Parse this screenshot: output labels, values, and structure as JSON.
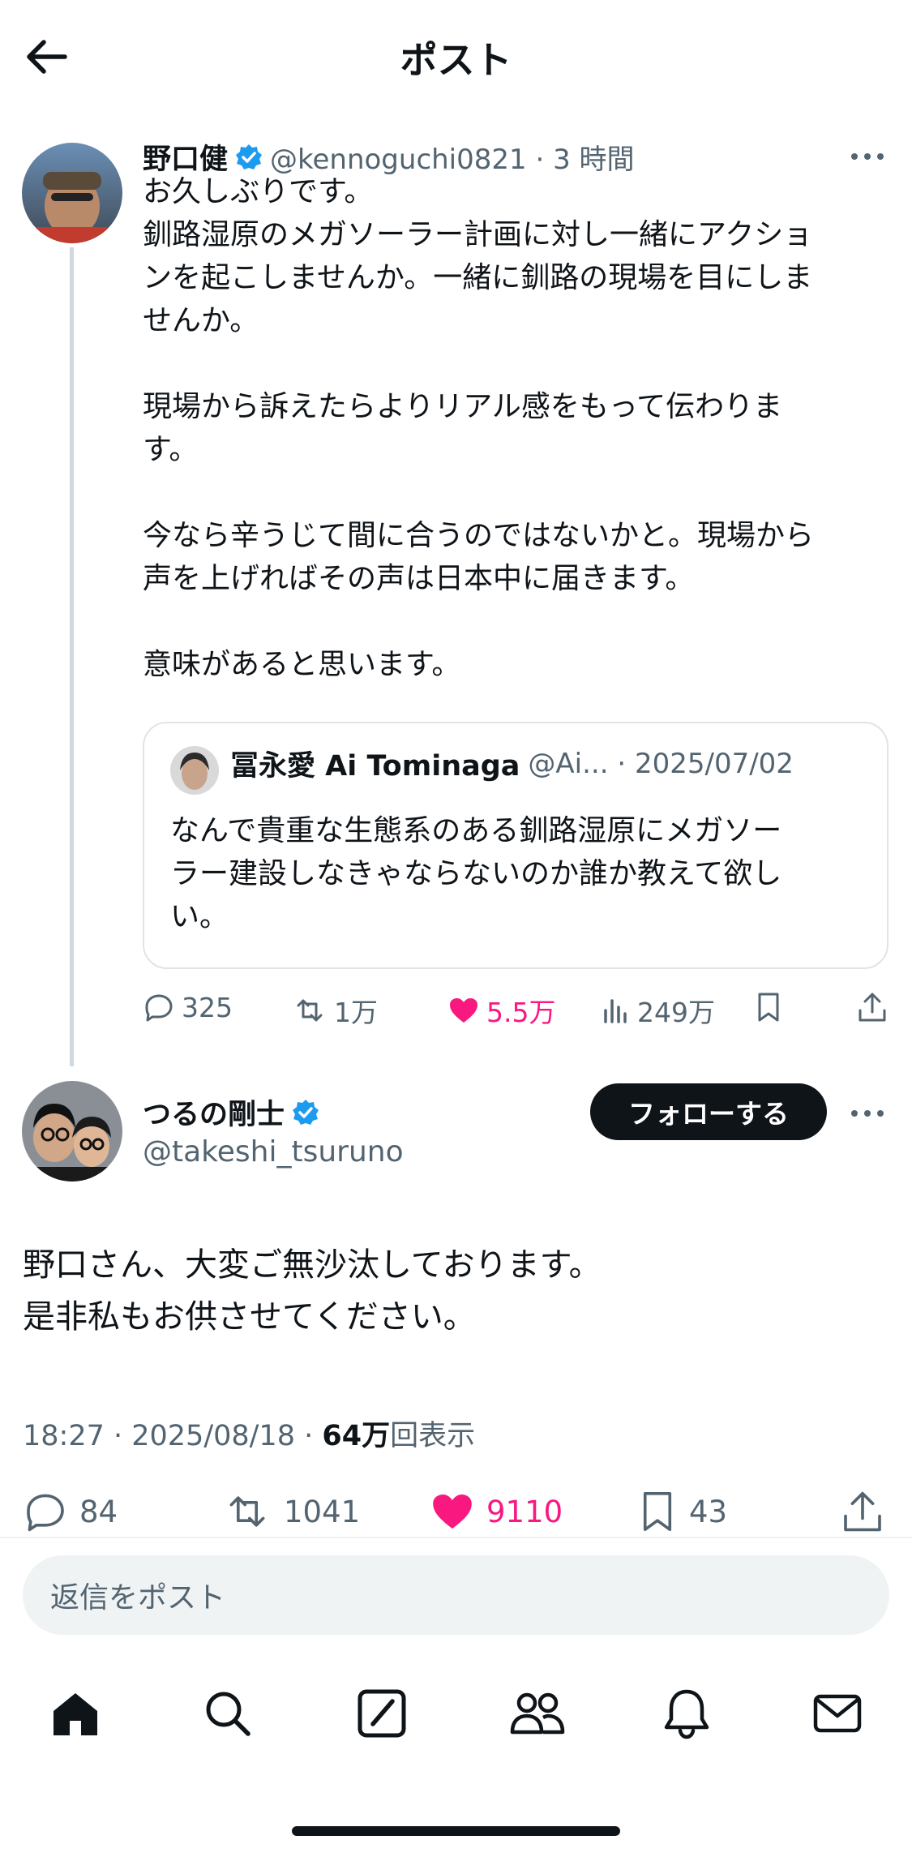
{
  "header": {
    "title": "ポスト",
    "back_icon": "arrow-left-icon"
  },
  "parent_post": {
    "author_name": "野口健",
    "handle_time": "@kennoguchi0821 · 3 時間",
    "body": "お久しぶりです。\n釧路湿原のメガソーラー計画に対し一緒にアクショ\nンを起こしませんか。一緒に釧路の現場を目にしま\nせんか。\n\n現場から訴えたらよりリアル感をもって伝わりま\nす。\n\n今なら辛うじて間に合うのではないかと。現場から\n声を上げればその声は日本中に届きます。\n\n意味があると思います。",
    "quote": {
      "author_name": "冨永愛 Ai Tominaga",
      "handle_date": "@Ai... · 2025/07/02",
      "body": "なんで貴重な生態系のある釧路湿原にメガソー\nラー建設しなきゃならないのか誰か教えて欲し\nい。"
    },
    "actions": {
      "replies": "325",
      "reposts": "1万",
      "likes": "5.5万",
      "views": "249万"
    }
  },
  "main_post": {
    "author_name": "つるの剛士",
    "handle": "@takeshi_tsuruno",
    "follow_label": "フォローする",
    "body": "野口さん、大変ご無沙汰しております。\n是非私もお供させてください。",
    "time_date": "18:27 · 2025/08/18 · ",
    "views_count": "64万",
    "views_label": "回表示",
    "stats": {
      "replies": "84",
      "reposts": "1041",
      "likes": "9110",
      "bookmarks": "43"
    }
  },
  "reply": {
    "placeholder": "返信をポスト"
  },
  "tabbar": {
    "items": [
      "home-icon",
      "search-icon",
      "compose-icon",
      "communities-icon",
      "notifications-icon",
      "messages-icon"
    ]
  },
  "colors": {
    "accent": "#1d9bf0",
    "like": "#f91880",
    "text": "#0f1419",
    "secondary": "#536471"
  }
}
